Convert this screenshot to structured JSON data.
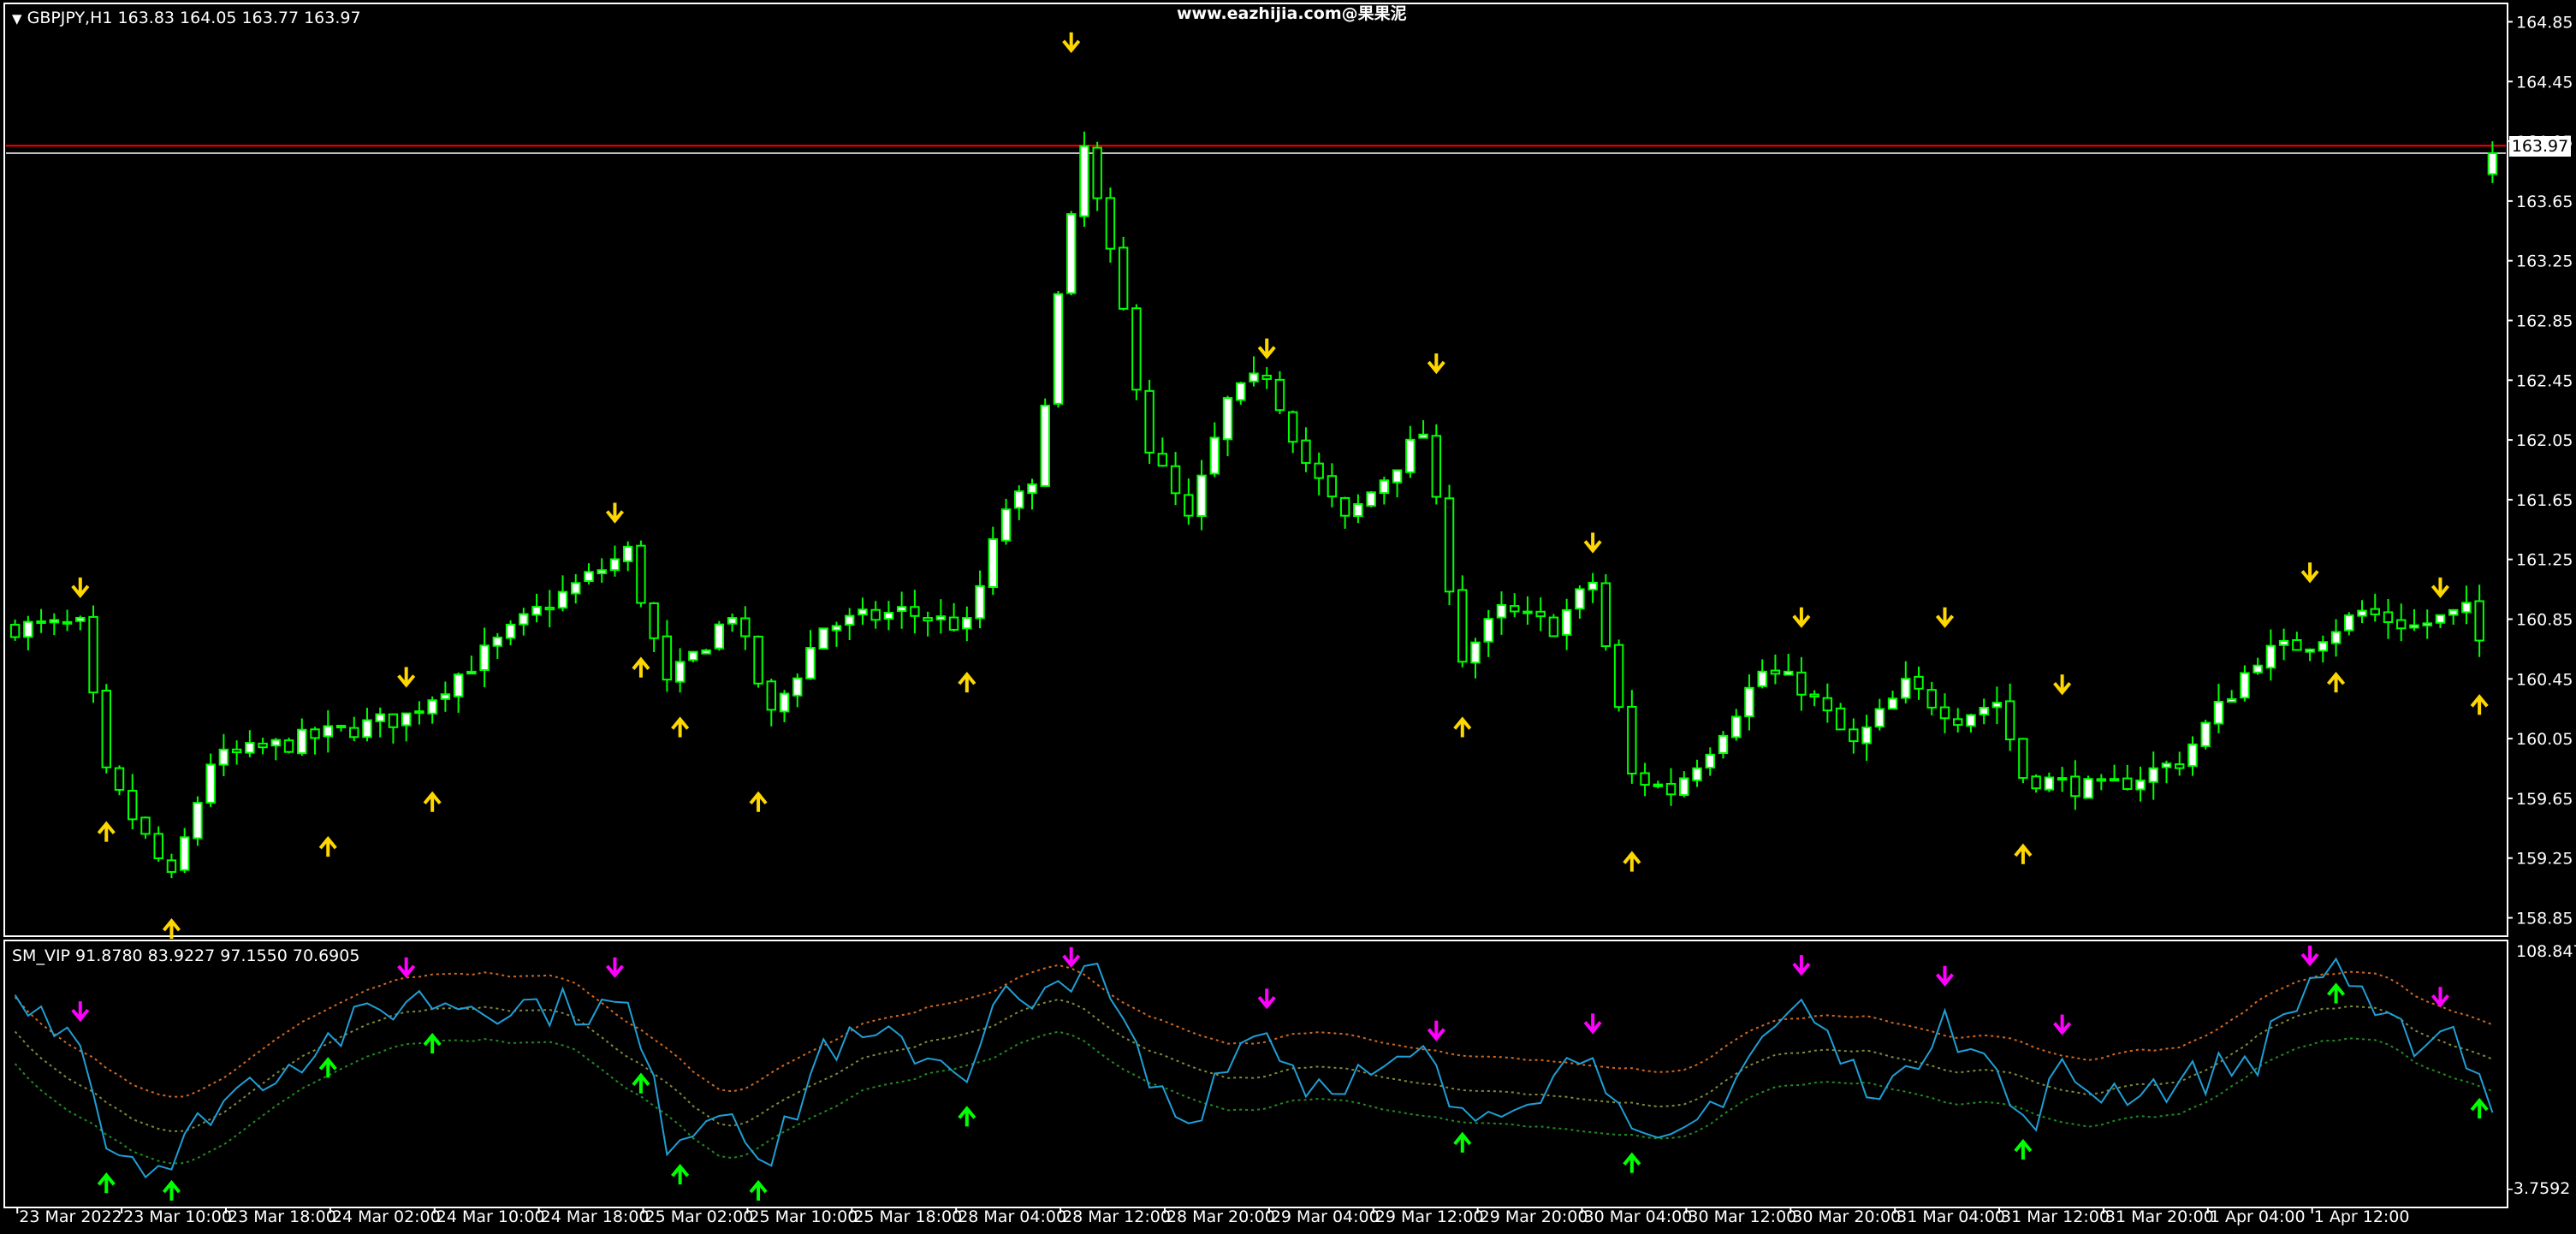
{
  "main": {
    "header": "GBPJPY,H1  163.83 164.05 163.77 163.97",
    "watermark": "www.eazhijia.com@果果泥",
    "price_label": "163.97",
    "price_ticks": [
      "164.85",
      "164.45",
      "164.05",
      "163.65",
      "163.25",
      "162.85",
      "162.45",
      "162.05",
      "161.65",
      "161.25",
      "160.85",
      "160.45",
      "160.05",
      "159.65",
      "159.25",
      "158.85"
    ]
  },
  "sub": {
    "header": "SM_VIP 91.8780 83.9227 97.1550 70.6905",
    "tick_top": "108.8472",
    "tick_bottom": "-3.7592"
  },
  "time_ticks": [
    "23 Mar 2022",
    "23 Mar 10:00",
    "23 Mar 18:00",
    "24 Mar 02:00",
    "24 Mar 10:00",
    "24 Mar 18:00",
    "25 Mar 02:00",
    "25 Mar 10:00",
    "25 Mar 18:00",
    "28 Mar 04:00",
    "28 Mar 12:00",
    "28 Mar 20:00",
    "29 Mar 04:00",
    "29 Mar 12:00",
    "29 Mar 20:00",
    "30 Mar 04:00",
    "30 Mar 12:00",
    "30 Mar 20:00",
    "31 Mar 04:00",
    "31 Mar 12:00",
    "31 Mar 20:00",
    "1 Apr 04:00",
    "1 Apr 12:00"
  ],
  "colors": {
    "bg": "#000000",
    "frame": "#ffffff",
    "bull": "#ffffff",
    "bear": "#000000",
    "wick": "#00ff00",
    "line_red": "#ff0000",
    "line_gray": "#c0c0c0",
    "arrow_yellow": "#ffd700",
    "arrow_magenta": "#ff00ff",
    "arrow_green": "#00ff00",
    "osc": "#1f9fd6",
    "band_upper": "#d2691e",
    "band_mid": "#7f8a3a",
    "band_lower": "#228b22"
  },
  "chart_data": [
    {
      "type": "candlestick",
      "symbol": "GBPJPY",
      "timeframe": "H1",
      "ohlc_last": {
        "open": 163.83,
        "high": 164.05,
        "low": 163.77,
        "close": 163.97
      },
      "ylim": [
        158.75,
        164.95
      ],
      "hlines": [
        {
          "value": 164.02,
          "color": "#ff0000"
        },
        {
          "value": 163.97,
          "color": "#c0c0c0"
        }
      ],
      "anchors": [
        [
          0,
          160.8
        ],
        [
          5,
          160.8
        ],
        [
          7,
          159.8
        ],
        [
          12,
          159.1
        ],
        [
          15,
          159.9
        ],
        [
          20,
          160.0
        ],
        [
          30,
          160.2
        ],
        [
          40,
          160.9
        ],
        [
          47,
          161.3
        ],
        [
          50,
          160.4
        ],
        [
          55,
          160.9
        ],
        [
          58,
          160.2
        ],
        [
          62,
          160.8
        ],
        [
          68,
          160.9
        ],
        [
          73,
          160.8
        ],
        [
          76,
          161.6
        ],
        [
          78,
          161.7
        ],
        [
          80,
          163.0
        ],
        [
          82,
          164.0
        ],
        [
          85,
          162.9
        ],
        [
          87,
          162.0
        ],
        [
          90,
          161.5
        ],
        [
          93,
          162.3
        ],
        [
          96,
          162.5
        ],
        [
          99,
          161.9
        ],
        [
          102,
          161.5
        ],
        [
          105,
          161.8
        ],
        [
          108,
          162.1
        ],
        [
          111,
          160.6
        ],
        [
          114,
          160.9
        ],
        [
          118,
          160.8
        ],
        [
          121,
          161.1
        ],
        [
          124,
          159.8
        ],
        [
          127,
          159.7
        ],
        [
          130,
          160.0
        ],
        [
          134,
          160.5
        ],
        [
          137,
          160.4
        ],
        [
          141,
          160.0
        ],
        [
          145,
          160.4
        ],
        [
          149,
          160.2
        ],
        [
          152,
          160.3
        ],
        [
          154,
          159.8
        ],
        [
          160,
          159.7
        ],
        [
          166,
          159.9
        ],
        [
          172,
          160.6
        ],
        [
          176,
          160.7
        ],
        [
          180,
          160.9
        ],
        [
          184,
          160.8
        ],
        [
          188,
          160.9
        ],
        [
          190,
          160.5
        ]
      ],
      "arrows": [
        {
          "i": 5,
          "dir": "down",
          "value": 160.9
        },
        {
          "i": 7,
          "dir": "up",
          "value": 159.6
        },
        {
          "i": 12,
          "dir": "up",
          "value": 158.95
        },
        {
          "i": 24,
          "dir": "up",
          "value": 159.5
        },
        {
          "i": 30,
          "dir": "down",
          "value": 160.3
        },
        {
          "i": 32,
          "dir": "up",
          "value": 159.8
        },
        {
          "i": 46,
          "dir": "down",
          "value": 161.4
        },
        {
          "i": 48,
          "dir": "up",
          "value": 160.7
        },
        {
          "i": 51,
          "dir": "up",
          "value": 160.3
        },
        {
          "i": 57,
          "dir": "up",
          "value": 159.8
        },
        {
          "i": 73,
          "dir": "up",
          "value": 160.6
        },
        {
          "i": 81,
          "dir": "down",
          "value": 164.55
        },
        {
          "i": 96,
          "dir": "down",
          "value": 162.5
        },
        {
          "i": 109,
          "dir": "down",
          "value": 162.4
        },
        {
          "i": 111,
          "dir": "up",
          "value": 160.3
        },
        {
          "i": 121,
          "dir": "down",
          "value": 161.2
        },
        {
          "i": 124,
          "dir": "up",
          "value": 159.4
        },
        {
          "i": 137,
          "dir": "down",
          "value": 160.7
        },
        {
          "i": 148,
          "dir": "down",
          "value": 160.7
        },
        {
          "i": 154,
          "dir": "up",
          "value": 159.45
        },
        {
          "i": 157,
          "dir": "down",
          "value": 160.25
        },
        {
          "i": 176,
          "dir": "down",
          "value": 161.0
        },
        {
          "i": 178,
          "dir": "up",
          "value": 160.6
        },
        {
          "i": 186,
          "dir": "down",
          "value": 160.9
        },
        {
          "i": 189,
          "dir": "up",
          "value": 160.45
        }
      ]
    },
    {
      "type": "line",
      "name": "SM_VIP",
      "ylim": [
        -3.7592,
        108.8472
      ],
      "anchors": [
        [
          0,
          82
        ],
        [
          5,
          72
        ],
        [
          7,
          22
        ],
        [
          12,
          12
        ],
        [
          15,
          38
        ],
        [
          20,
          55
        ],
        [
          30,
          85
        ],
        [
          40,
          82
        ],
        [
          47,
          80
        ],
        [
          50,
          25
        ],
        [
          55,
          40
        ],
        [
          58,
          12
        ],
        [
          62,
          65
        ],
        [
          68,
          65
        ],
        [
          73,
          55
        ],
        [
          76,
          88
        ],
        [
          78,
          75
        ],
        [
          80,
          92
        ],
        [
          82,
          102
        ],
        [
          85,
          72
        ],
        [
          87,
          48
        ],
        [
          90,
          30
        ],
        [
          93,
          62
        ],
        [
          96,
          72
        ],
        [
          99,
          48
        ],
        [
          102,
          52
        ],
        [
          105,
          50
        ],
        [
          108,
          60
        ],
        [
          111,
          30
        ],
        [
          114,
          42
        ],
        [
          118,
          50
        ],
        [
          121,
          68
        ],
        [
          124,
          20
        ],
        [
          127,
          18
        ],
        [
          130,
          38
        ],
        [
          134,
          68
        ],
        [
          137,
          82
        ],
        [
          141,
          52
        ],
        [
          145,
          47
        ],
        [
          148,
          85
        ],
        [
          149,
          70
        ],
        [
          152,
          52
        ],
        [
          154,
          28
        ],
        [
          157,
          52
        ],
        [
          160,
          45
        ],
        [
          166,
          48
        ],
        [
          172,
          60
        ],
        [
          176,
          92
        ],
        [
          178,
          102
        ],
        [
          181,
          72
        ],
        [
          184,
          68
        ],
        [
          187,
          72
        ],
        [
          190,
          40
        ]
      ],
      "bands": {
        "upper_offset": 15,
        "middle_offset": 0,
        "lower_offset": -14
      },
      "arrows": [
        {
          "i": 5,
          "dir": "down",
          "color": "magenta"
        },
        {
          "i": 7,
          "dir": "up",
          "color": "green"
        },
        {
          "i": 12,
          "dir": "up",
          "color": "green"
        },
        {
          "i": 24,
          "dir": "up",
          "color": "green"
        },
        {
          "i": 30,
          "dir": "down",
          "color": "magenta"
        },
        {
          "i": 32,
          "dir": "up",
          "color": "green"
        },
        {
          "i": 46,
          "dir": "down",
          "color": "magenta"
        },
        {
          "i": 48,
          "dir": "up",
          "color": "green"
        },
        {
          "i": 51,
          "dir": "up",
          "color": "green"
        },
        {
          "i": 57,
          "dir": "up",
          "color": "green"
        },
        {
          "i": 73,
          "dir": "up",
          "color": "green"
        },
        {
          "i": 81,
          "dir": "down",
          "color": "magenta"
        },
        {
          "i": 96,
          "dir": "down",
          "color": "magenta"
        },
        {
          "i": 109,
          "dir": "down",
          "color": "magenta"
        },
        {
          "i": 111,
          "dir": "up",
          "color": "green"
        },
        {
          "i": 121,
          "dir": "down",
          "color": "magenta"
        },
        {
          "i": 124,
          "dir": "up",
          "color": "green"
        },
        {
          "i": 137,
          "dir": "down",
          "color": "magenta"
        },
        {
          "i": 148,
          "dir": "down",
          "color": "magenta"
        },
        {
          "i": 154,
          "dir": "up",
          "color": "green"
        },
        {
          "i": 157,
          "dir": "down",
          "color": "magenta"
        },
        {
          "i": 176,
          "dir": "down",
          "color": "magenta"
        },
        {
          "i": 178,
          "dir": "up",
          "color": "green"
        },
        {
          "i": 186,
          "dir": "down",
          "color": "magenta"
        },
        {
          "i": 189,
          "dir": "up",
          "color": "green"
        }
      ]
    }
  ]
}
